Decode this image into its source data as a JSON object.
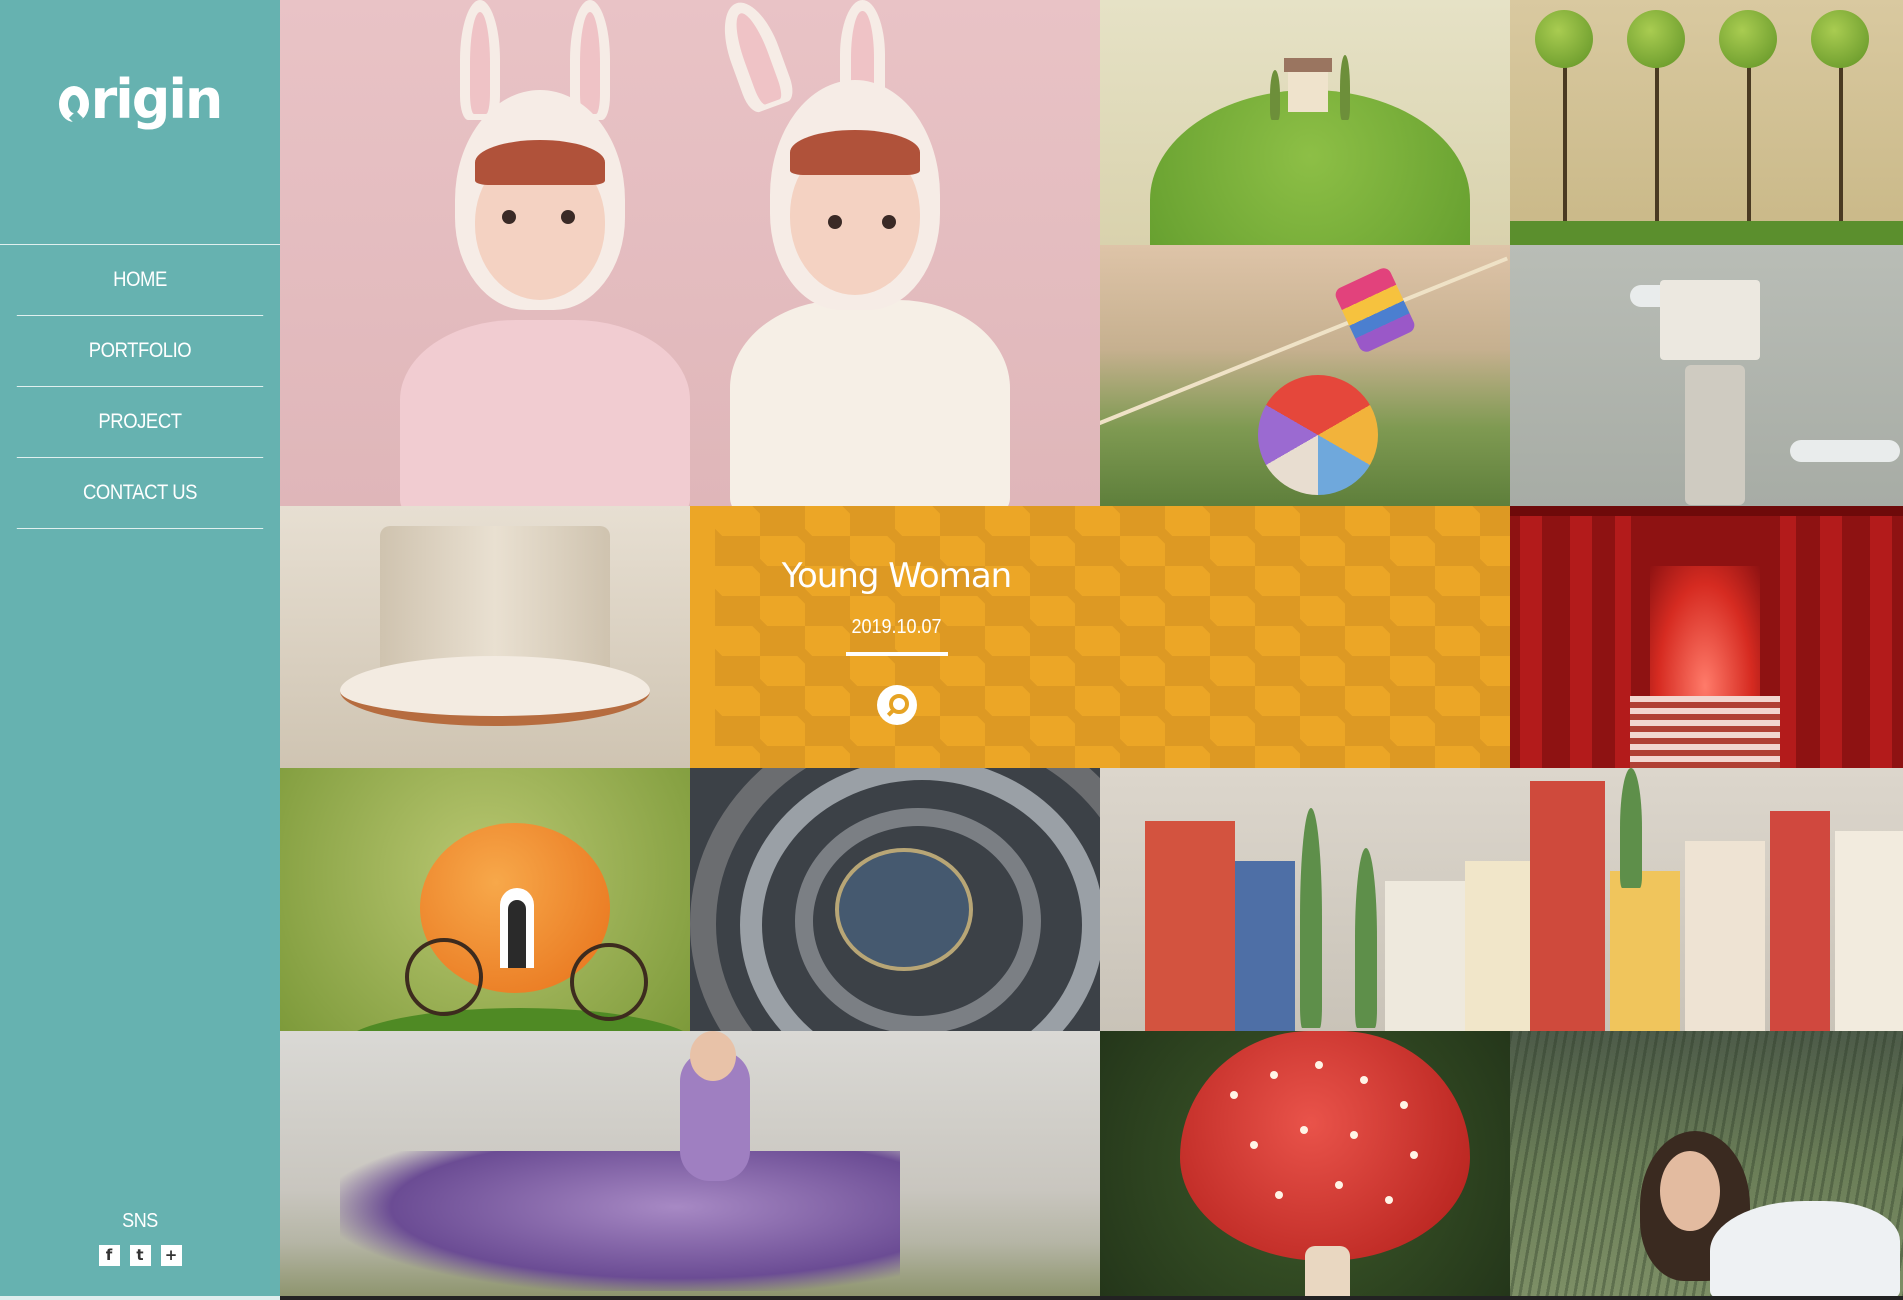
{
  "brand": {
    "logo_text": "rigin"
  },
  "nav": {
    "items": [
      {
        "label": "HOME"
      },
      {
        "label": "PORTFOLIO"
      },
      {
        "label": "PROJECT"
      },
      {
        "label": "CONTACT US"
      }
    ]
  },
  "sns": {
    "label": "SNS",
    "icons": [
      {
        "name": "facebook-icon",
        "glyph": "f"
      },
      {
        "name": "twitter-icon",
        "glyph": "t"
      },
      {
        "name": "plus-icon",
        "glyph": "+"
      }
    ]
  },
  "featured": {
    "title": "Young Woman",
    "date": "2019.10.07",
    "action_icon": "search-icon"
  },
  "colors": {
    "sidebar_bg": "#66b2b0",
    "featured_overlay": "#e6a324",
    "text_on_dark": "#ffffff"
  }
}
